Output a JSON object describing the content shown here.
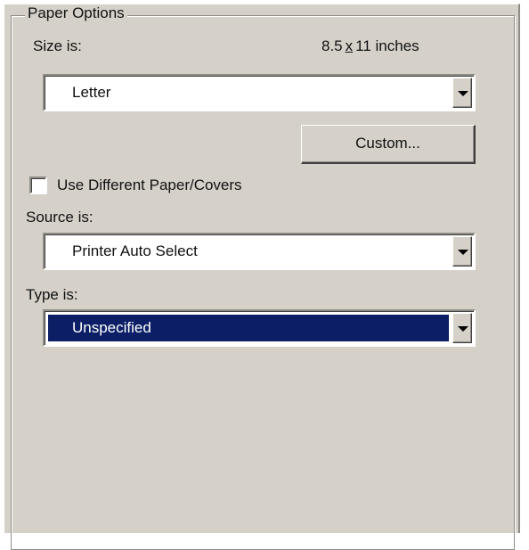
{
  "group": {
    "title": "Paper Options"
  },
  "size": {
    "label": "Size is:",
    "width_value": "8.5",
    "times_symbol": "x",
    "height_value": "11 inches",
    "selected": "Letter",
    "custom_button": "Custom..."
  },
  "covers": {
    "label": "Use Different Paper/Covers",
    "checked": false
  },
  "source": {
    "label": "Source is:",
    "selected": "Printer Auto Select"
  },
  "type": {
    "label": "Type is:",
    "selected": "Unspecified"
  },
  "colors": {
    "panel_bg": "#d5d1c9",
    "selection_bg": "#0c1f66",
    "selection_text": "#ffffff"
  },
  "icons": {
    "dropdown": "chevron-down-icon"
  }
}
